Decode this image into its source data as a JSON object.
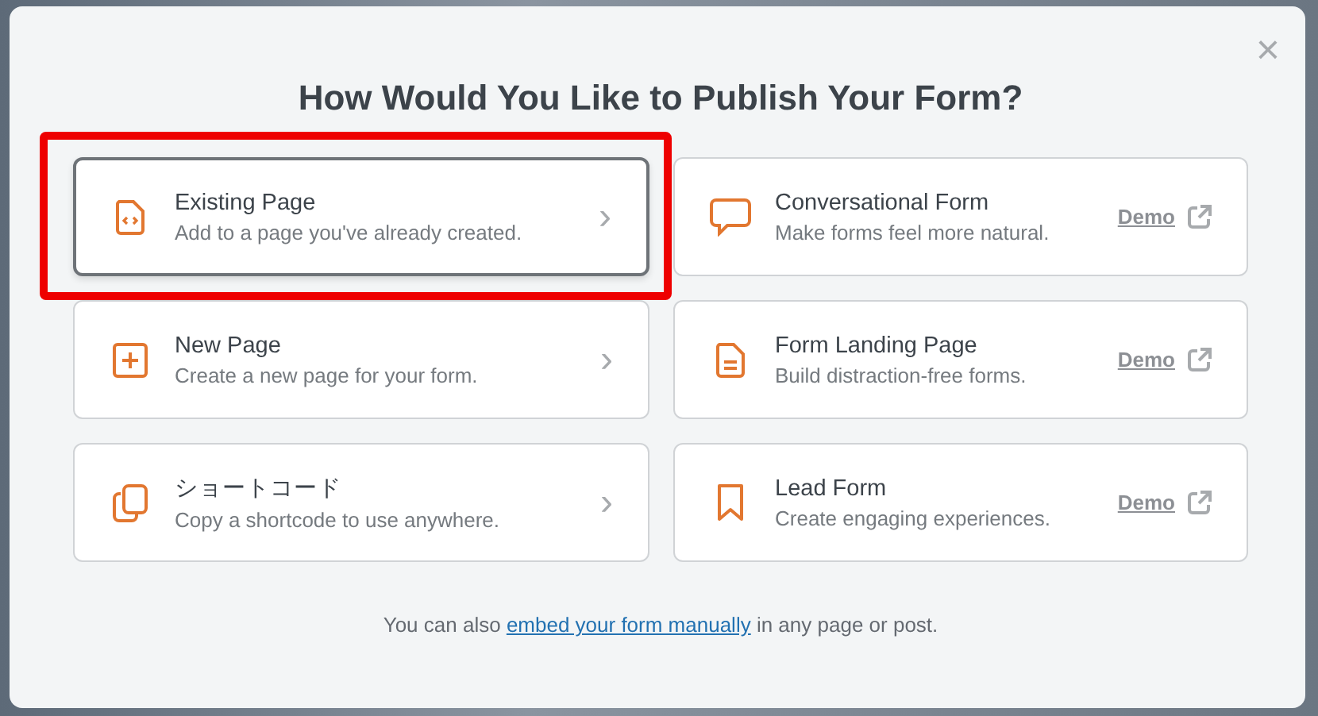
{
  "dialog": {
    "title": "How Would You Like to Publish Your Form?",
    "close": "×"
  },
  "options": [
    {
      "kind": "chevron",
      "title": "Existing Page",
      "description": "Add to a page you've already created.",
      "selected": true,
      "highlighted": true,
      "arrow": "›"
    },
    {
      "kind": "chevron",
      "title": "New Page",
      "description": "Create a new page for your form.",
      "selected": false,
      "highlighted": false,
      "arrow": "›"
    },
    {
      "kind": "chevron",
      "title": "ショートコード",
      "description": "Copy a shortcode to use anywhere.",
      "selected": false,
      "highlighted": false,
      "arrow": "›"
    },
    {
      "kind": "demo",
      "title": "Conversational Form",
      "description": "Make forms feel more natural.",
      "selected": false,
      "link": "Demo"
    },
    {
      "kind": "demo",
      "title": "Form Landing Page",
      "description": "Build distraction-free forms.",
      "selected": false,
      "link": "Demo"
    },
    {
      "kind": "demo",
      "title": "Lead Form",
      "description": "Create engaging experiences.",
      "selected": false,
      "link": "Demo"
    }
  ],
  "footer": {
    "before": "You can also ",
    "link": "embed your form manually",
    "after": " in any page or post."
  }
}
